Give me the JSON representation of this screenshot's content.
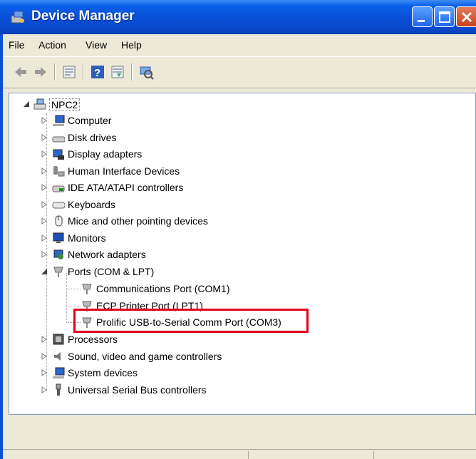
{
  "window": {
    "title": "Device Manager"
  },
  "menu": [
    "File",
    "Action",
    "View",
    "Help"
  ],
  "toolbar": [
    "back-icon",
    "forward-icon",
    "properties-icon",
    "help-icon",
    "update-driver-icon",
    "scan-hardware-icon"
  ],
  "tree": {
    "root": "NPC2",
    "categories": [
      {
        "label": "Computer",
        "icon": "computer-icon"
      },
      {
        "label": "Disk drives",
        "icon": "disk-drive-icon"
      },
      {
        "label": "Display adapters",
        "icon": "display-adapter-icon"
      },
      {
        "label": "Human Interface Devices",
        "icon": "hid-icon"
      },
      {
        "label": "IDE ATA/ATAPI controllers",
        "icon": "ide-controller-icon"
      },
      {
        "label": "Keyboards",
        "icon": "keyboard-icon"
      },
      {
        "label": "Mice and other pointing devices",
        "icon": "mouse-icon"
      },
      {
        "label": "Monitors",
        "icon": "monitor-icon"
      },
      {
        "label": "Network adapters",
        "icon": "network-adapter-icon"
      },
      {
        "label": "Ports (COM & LPT)",
        "icon": "port-icon",
        "expanded": true
      },
      {
        "label": "Processors",
        "icon": "processor-icon"
      },
      {
        "label": "Sound, video and game controllers",
        "icon": "sound-icon"
      },
      {
        "label": "System devices",
        "icon": "system-device-icon"
      },
      {
        "label": "Universal Serial Bus controllers",
        "icon": "usb-icon"
      }
    ],
    "ports_children": [
      {
        "label": "Communications Port (COM1)"
      },
      {
        "label": "ECP Printer Port (LPT1)"
      },
      {
        "label": "Prolific USB-to-Serial Comm Port (COM3)",
        "highlighted": true
      }
    ]
  },
  "colors": {
    "title_blue": "#0a4fd6",
    "highlight_red": "#e3001b"
  }
}
